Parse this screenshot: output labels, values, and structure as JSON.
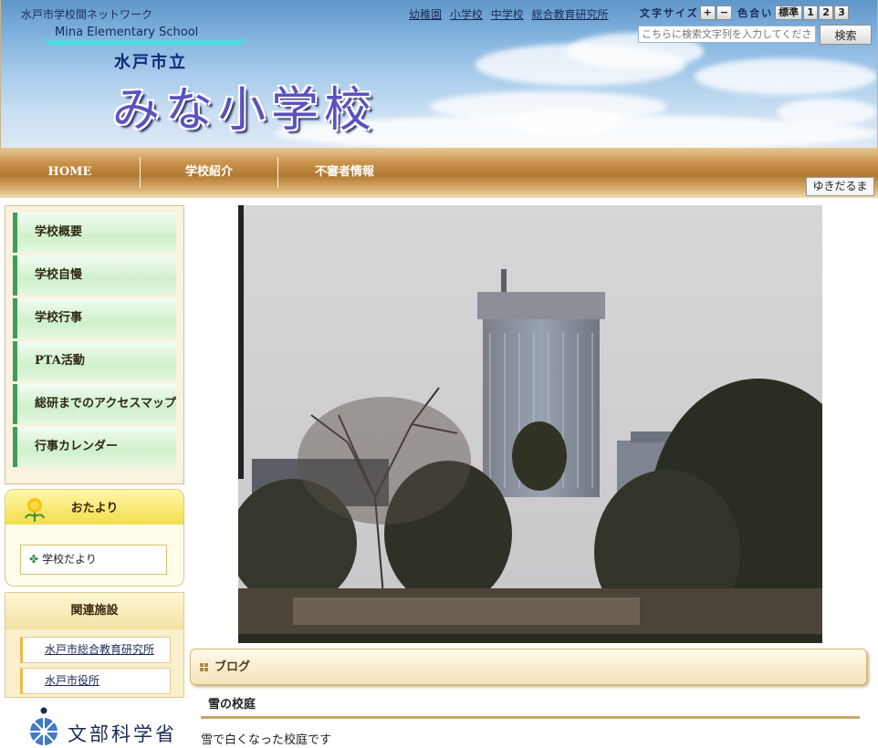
{
  "header": {
    "network_title": "水戸市学校間ネットワーク",
    "school_name_en": "Mina Elementary School",
    "city": "水戸市立",
    "school_name": "みな小学校",
    "links": [
      "幼稚園",
      "小学校",
      "中学校",
      "総合教育研究所"
    ],
    "font_size_label": "文字サイズ",
    "font_plus": "+",
    "font_minus": "−",
    "color_label": "色合い",
    "color_standard": "標準",
    "color_options": [
      "1",
      "2",
      "3"
    ],
    "search_placeholder": "こちらに検索文字列を入力してください",
    "search_button": "検索"
  },
  "nav": {
    "items": [
      "HOME",
      "学校紹介",
      "不審者情報"
    ],
    "snow_tag": "ゆきだるま"
  },
  "sidebar": {
    "menu": [
      "学校概要",
      "学校自慢",
      "学校行事",
      "PTA活動",
      "総研までのアクセスマップ",
      "行事カレンダー"
    ],
    "otayori_title": "おたより",
    "otayori_item": "学校だより",
    "related_title": "関連施設",
    "related_links": [
      "水戸市総合教育研究所",
      "水戸市役所"
    ],
    "mext_text": "文部科学省"
  },
  "main": {
    "blog_title": "ブログ",
    "post_title": "雪の校庭",
    "post_body": "雪で白くなった校庭です"
  },
  "colors": {
    "nav_gold": "#b07930",
    "menu_green": "#3ba055",
    "school_name": "#5a52c0"
  }
}
